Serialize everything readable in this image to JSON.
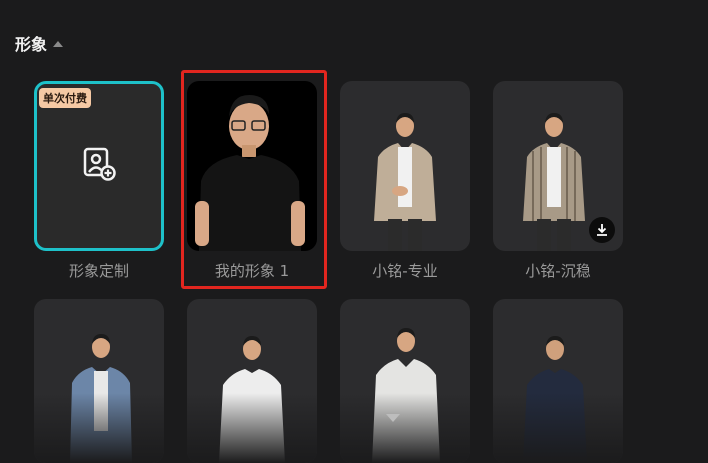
{
  "section": {
    "title": "形象"
  },
  "cards": [
    {
      "label": "形象定制",
      "badge": "单次付费"
    },
    {
      "label": "我的形象 1"
    },
    {
      "label": "小铭-专业"
    },
    {
      "label": "小铭-沉稳"
    }
  ],
  "colors": {
    "accent_teal": "#1ec1c9",
    "highlight_red": "#e2261f",
    "badge_bg": "#f6c9a4"
  },
  "icons": {
    "custom": "portrait-add-icon",
    "download": "download-icon",
    "collapse": "caret-up-icon",
    "more": "caret-down-icon"
  }
}
